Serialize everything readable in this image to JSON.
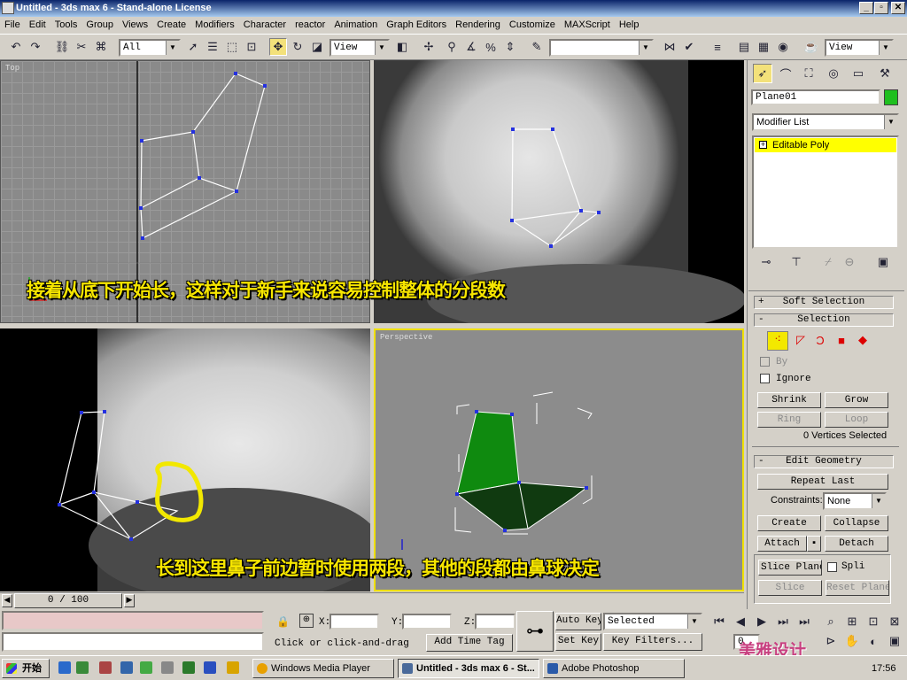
{
  "window": {
    "title": "Untitled - 3ds max 6 - Stand-alone License",
    "min": "_",
    "max": "▫",
    "close": "✕"
  },
  "menu": [
    "File",
    "Edit",
    "Tools",
    "Group",
    "Views",
    "Create",
    "Modifiers",
    "Character",
    "reactor",
    "Animation",
    "Graph Editors",
    "Rendering",
    "Customize",
    "MAXScript",
    "Help"
  ],
  "toolbar": {
    "filter": "All",
    "ref_coord_left": "View",
    "ref_coord_right": "View",
    "named_sel": ""
  },
  "viewports": {
    "top": "Top",
    "perspective": "Perspective"
  },
  "captions": {
    "top": "接着从底下开始长，这样对于新手来说容易控制整体的分段数",
    "bottom": "长到这里鼻子前边暂时使用两段，其他的段都由鼻球决定"
  },
  "panel": {
    "object_name": "Plane01",
    "object_color": "#1fbf1f",
    "modifier_list": "Modifier List",
    "stack_item": "Editable Poly",
    "soft_selection": "Soft Selection",
    "selection": "Selection",
    "by_vertex": "By",
    "ignore": "Ignore",
    "shrink": "Shrink",
    "grow": "Grow",
    "ring": "Ring",
    "loop": "Loop",
    "sel_status": "0 Vertices Selected",
    "edit_geometry": "Edit Geometry",
    "repeat_last": "Repeat Last",
    "constraints_label": "Constraints:",
    "constraints_value": "None",
    "create": "Create",
    "collapse": "Collapse",
    "attach": "Attach",
    "detach": "Detach",
    "slice_plane": "Slice Plane",
    "split": "Spli",
    "slice": "Slice",
    "reset_plane": "Reset Plane"
  },
  "bottom": {
    "time_slider": "0 / 100",
    "x_label": "X:",
    "y_label": "Y:",
    "z_label": "Z:",
    "prompt": "Click or click-and-drag",
    "add_time_tag": "Add Time Tag",
    "auto_key": "Auto Key",
    "set_key": "Set Key",
    "key_selected": "Selected",
    "key_filters": "Key Filters...",
    "frame": "0"
  },
  "taskbar": {
    "start": "开始",
    "tasks": [
      "Windows Media Player",
      "Untitled - 3ds max 6 - St...",
      "Adobe Photoshop"
    ],
    "clock": "17:56"
  },
  "watermark": "美雅设计"
}
